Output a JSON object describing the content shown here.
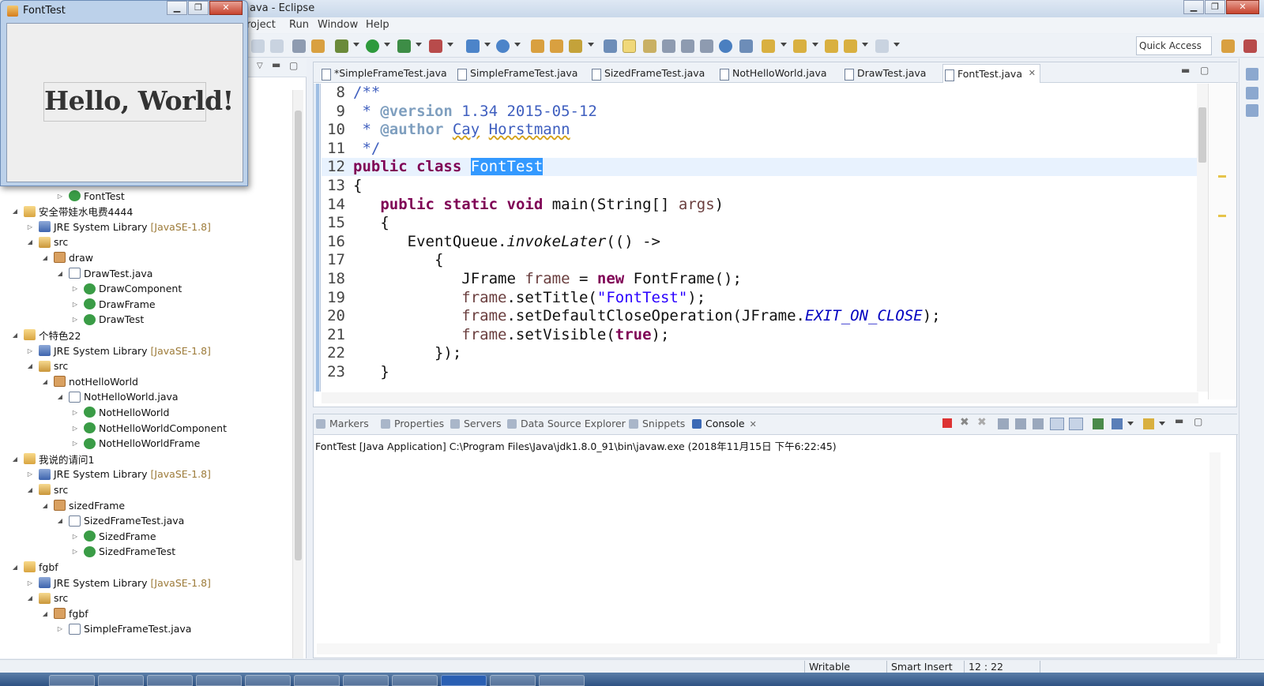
{
  "eclipse": {
    "title": "ava - Eclipse",
    "menu": [
      "roject",
      "Run",
      "Window",
      "Help"
    ],
    "quick_access": "Quick Access"
  },
  "explorer": {
    "items": [
      {
        "label": "FontTest",
        "icon": "class-icon",
        "indent": 3,
        "twisty": "▷"
      },
      {
        "label": "安全带娃水电费4444",
        "icon": "project-icon",
        "indent": 0,
        "twisty": "◢"
      },
      {
        "label": "JRE System Library",
        "qual": "[JavaSE-1.8]",
        "icon": "library-icon",
        "indent": 1,
        "twisty": "▷"
      },
      {
        "label": "src",
        "icon": "source-folder-icon",
        "indent": 1,
        "twisty": "◢"
      },
      {
        "label": "draw",
        "icon": "package-icon",
        "indent": 2,
        "twisty": "◢"
      },
      {
        "label": "DrawTest.java",
        "icon": "java-file-icon",
        "indent": 3,
        "twisty": "◢"
      },
      {
        "label": "DrawComponent",
        "icon": "class-icon",
        "indent": 4,
        "twisty": "▷"
      },
      {
        "label": "DrawFrame",
        "icon": "class-icon",
        "indent": 4,
        "twisty": "▷"
      },
      {
        "label": "DrawTest",
        "icon": "class-icon",
        "indent": 4,
        "twisty": "▷"
      },
      {
        "label": "个特色22",
        "icon": "project-icon",
        "indent": 0,
        "twisty": "◢"
      },
      {
        "label": "JRE System Library",
        "qual": "[JavaSE-1.8]",
        "icon": "library-icon",
        "indent": 1,
        "twisty": "▷"
      },
      {
        "label": "src",
        "icon": "source-folder-icon",
        "indent": 1,
        "twisty": "◢"
      },
      {
        "label": "notHelloWorld",
        "icon": "package-icon",
        "indent": 2,
        "twisty": "◢"
      },
      {
        "label": "NotHelloWorld.java",
        "icon": "java-file-icon",
        "indent": 3,
        "twisty": "◢"
      },
      {
        "label": "NotHelloWorld",
        "icon": "class-icon",
        "indent": 4,
        "twisty": "▷"
      },
      {
        "label": "NotHelloWorldComponent",
        "icon": "class-icon",
        "indent": 4,
        "twisty": "▷"
      },
      {
        "label": "NotHelloWorldFrame",
        "icon": "class-icon",
        "indent": 4,
        "twisty": "▷"
      },
      {
        "label": "我说的请问1",
        "icon": "project-icon",
        "indent": 0,
        "twisty": "◢"
      },
      {
        "label": "JRE System Library",
        "qual": "[JavaSE-1.8]",
        "icon": "library-icon",
        "indent": 1,
        "twisty": "▷"
      },
      {
        "label": "src",
        "icon": "source-folder-icon",
        "indent": 1,
        "twisty": "◢"
      },
      {
        "label": "sizedFrame",
        "icon": "package-icon",
        "indent": 2,
        "twisty": "◢"
      },
      {
        "label": "SizedFrameTest.java",
        "icon": "java-file-icon",
        "indent": 3,
        "twisty": "◢"
      },
      {
        "label": "SizedFrame",
        "icon": "class-icon",
        "indent": 4,
        "twisty": "▷"
      },
      {
        "label": "SizedFrameTest",
        "icon": "class-icon",
        "indent": 4,
        "twisty": "▷"
      },
      {
        "label": "fgbf",
        "icon": "project-icon",
        "indent": 0,
        "twisty": "◢"
      },
      {
        "label": "JRE System Library",
        "qual": "[JavaSE-1.8]",
        "icon": "library-icon",
        "indent": 1,
        "twisty": "▷"
      },
      {
        "label": "src",
        "icon": "source-folder-icon",
        "indent": 1,
        "twisty": "◢"
      },
      {
        "label": "fgbf",
        "icon": "package-icon",
        "indent": 2,
        "twisty": "◢"
      },
      {
        "label": "SimpleFrameTest.java",
        "icon": "java-file-icon",
        "indent": 3,
        "twisty": "▷"
      }
    ]
  },
  "editor": {
    "tabs": [
      {
        "label": "*SimpleFrameTest.java",
        "active": false
      },
      {
        "label": "SimpleFrameTest.java",
        "active": false
      },
      {
        "label": "SizedFrameTest.java",
        "active": false
      },
      {
        "label": "NotHelloWorld.java",
        "active": false
      },
      {
        "label": "DrawTest.java",
        "active": false
      },
      {
        "label": "FontTest.java",
        "active": true
      }
    ],
    "lines": [
      {
        "n": "8",
        "fold": true,
        "html": "<span class=\"cm\">/**</span>"
      },
      {
        "n": "9",
        "html": "<span class=\"cm\"> * </span><span class=\"cmtag\">@version</span><span class=\"cm\"> 1.34 2015-05-12</span>"
      },
      {
        "n": "10",
        "html": "<span class=\"cm\"> * </span><span class=\"cmtag\">@author</span><span class=\"cm\"> <span class=\"sq\">Cay</span> <span class=\"sq\">Horstmann</span></span>"
      },
      {
        "n": "11",
        "html": "<span class=\"cm\"> */</span>"
      },
      {
        "n": "12",
        "current": true,
        "html": "<span class=\"kw\">public</span> <span class=\"kw\">class</span> <span class=\"sel\">FontTest</span>"
      },
      {
        "n": "13",
        "html": "{"
      },
      {
        "n": "14",
        "fold": true,
        "html": "   <span class=\"kw\">public</span> <span class=\"kw\">static</span> <span class=\"kw\">void</span> main(String[] <span class=\"var\">args</span>)"
      },
      {
        "n": "15",
        "html": "   {"
      },
      {
        "n": "16",
        "html": "      EventQueue.<span class=\"mth\">invokeLater</span>(() -&gt;"
      },
      {
        "n": "17",
        "html": "         {"
      },
      {
        "n": "18",
        "html": "            JFrame <span class=\"var\">frame</span> = <span class=\"kw\">new</span> FontFrame();"
      },
      {
        "n": "19",
        "html": "            <span class=\"var\">frame</span>.setTitle(<span class=\"str\">\"FontTest\"</span>);"
      },
      {
        "n": "20",
        "html": "            <span class=\"var\">frame</span>.setDefaultCloseOperation(JFrame.<span class=\"fld\">EXIT_ON_CLOSE</span>);"
      },
      {
        "n": "21",
        "html": "            <span class=\"var\">frame</span>.setVisible(<span class=\"kw\">true</span>);"
      },
      {
        "n": "22",
        "html": "         });"
      },
      {
        "n": "23",
        "html": "   }"
      }
    ]
  },
  "console": {
    "tabs": [
      {
        "label": "Markers",
        "active": false
      },
      {
        "label": "Properties",
        "active": false
      },
      {
        "label": "Servers",
        "active": false
      },
      {
        "label": "Data Source Explorer",
        "active": false
      },
      {
        "label": "Snippets",
        "active": false
      },
      {
        "label": "Console",
        "active": true
      }
    ],
    "process_line": "FontTest [Java Application] C:\\Program Files\\Java\\jdk1.8.0_91\\bin\\javaw.exe (2018年11月15日 下午6:22:45)"
  },
  "status": {
    "writable": "Writable",
    "insert_mode": "Smart Insert",
    "position": "12 : 22"
  },
  "fonttest_window": {
    "title": "FontTest",
    "message": "Hello, World!"
  },
  "colors": {
    "keyword": "#7f0055",
    "comment": "#3f5fbf",
    "string": "#2a00ff",
    "selection": "#3399ff"
  }
}
